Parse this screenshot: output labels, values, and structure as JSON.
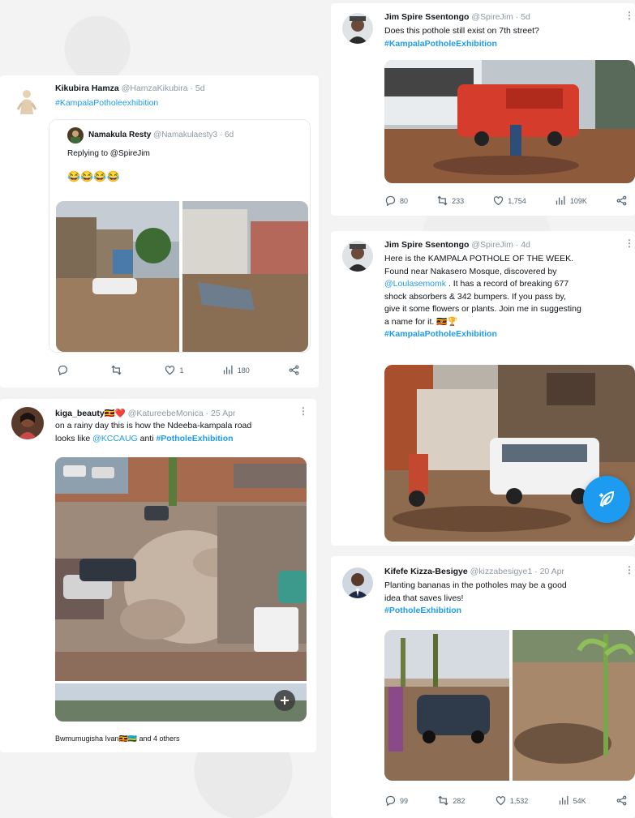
{
  "posts": {
    "kikubira": {
      "name": "Kikubira Hamza",
      "handle": "@HamzaKikubira · 5d",
      "hashtag": "#KampalaPotholeexhibition",
      "quote": {
        "name": "Namakula Resty",
        "handle": "@Namakulaesty3 · 6d",
        "reply": "Replying to @SpireJim",
        "emoji": "😂😂😂😂"
      },
      "stats": {
        "replies": "",
        "reposts": "",
        "likes": "1",
        "views": "180"
      }
    },
    "kiga": {
      "name": "kiga_beauty🇺🇬❤️",
      "handle": "@KatureebeMonica · 25 Apr",
      "text_a": "on a rainy day this is how the Ndeeba-kampala road",
      "text_b_pre": "looks like ",
      "mention": "@KCCAUG",
      "text_b_mid": " anti ",
      "hashtag": "#PotholeExhibition",
      "footer": "Bwmumugisha Ivan🇺🇬🇷🇼 and 4 others"
    },
    "jim1": {
      "name": "Jim Spire Ssentongo",
      "handle": "@SpireJim · 5d",
      "text": "Does this pothole still exist on 7th street?",
      "hashtag": "#KampalaPotholeExhibition",
      "stats": {
        "replies": "80",
        "reposts": "233",
        "likes": "1,754",
        "views": "109K"
      }
    },
    "jim2": {
      "name": "Jim Spire Ssentongo",
      "handle": "@SpireJim · 4d",
      "line1": "Here is the KAMPALA POTHOLE OF THE WEEK.",
      "line2": "Found near Nakasero Mosque, discovered by",
      "mention": "@Loulasemomk",
      "line3_rest": " . It has a record of breaking 677",
      "line4": "shock absorbers & 342  bumpers. If you pass by,",
      "line5": "give it some flowers or plants. Join me in suggesting",
      "line6": "a name for it. 🇺🇬🏆",
      "hashtag": "#KampalaPotholeExhibition"
    },
    "kifefe": {
      "name": "Kifefe Kizza-Besigye",
      "handle": "@kizzabesigye1 · 20 Apr",
      "line1": "Planting bananas in the potholes may be a good",
      "line2": "idea that saves lives!",
      "hashtag": "#PotholeExhibition",
      "stats": {
        "replies": "99",
        "reposts": "282",
        "likes": "1,532",
        "views": "54K"
      }
    }
  },
  "more_glyph": "⋮",
  "colors": {
    "accent": "#1d9bf0",
    "muted": "#536471",
    "name": "#0f1419"
  }
}
